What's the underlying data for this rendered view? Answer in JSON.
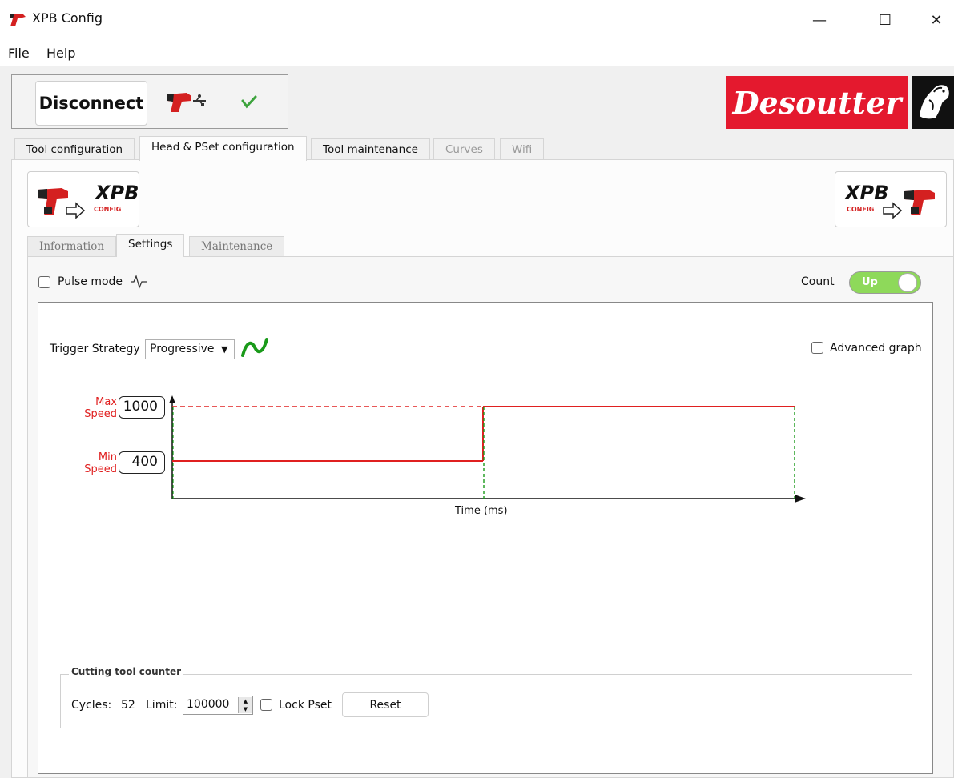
{
  "window": {
    "title": "XPB Config",
    "minimize_glyph": "—",
    "maximize_glyph": "☐",
    "close_glyph": "✕"
  },
  "menu": [
    "File",
    "Help"
  ],
  "connection": {
    "button_label": "Disconnect",
    "usb_icon": "drill-usb-icon",
    "status_icon": "check-icon",
    "status_color": "#3ca33c"
  },
  "brand": {
    "name": "Desoutter",
    "color": "#e4192e"
  },
  "main_tabs": [
    {
      "label": "Tool configuration",
      "state": "normal"
    },
    {
      "label": "Head & PSet configuration",
      "state": "active"
    },
    {
      "label": "Tool maintenance",
      "state": "normal"
    },
    {
      "label": "Curves",
      "state": "disabled"
    },
    {
      "label": "Wifi",
      "state": "disabled"
    }
  ],
  "xpb_buttons": {
    "left": {
      "title": "XPB",
      "subtitle": "CONFIG",
      "icon": "drill-to-xpb-icon"
    },
    "right": {
      "title": "XPB",
      "subtitle": "CONFIG",
      "icon": "xpb-to-drill-icon"
    }
  },
  "sub_tabs": [
    {
      "label": "Information",
      "state": "normal"
    },
    {
      "label": "Settings",
      "state": "active"
    },
    {
      "label": "Maintenance",
      "state": "normal"
    }
  ],
  "settings": {
    "pulse_mode_label": "Pulse mode",
    "pulse_mode_checked": false,
    "count_label": "Count",
    "count_toggle_label": "Up",
    "count_toggle_color": "#8ed95a",
    "trigger_strategy_label": "Trigger Strategy",
    "trigger_strategy_value": "Progressive",
    "advanced_graph_label": "Advanced graph",
    "advanced_graph_checked": false
  },
  "speed_graph": {
    "max_label_line1": "Max",
    "max_label_line2": "Speed",
    "min_label_line1": "Min",
    "min_label_line2": "Speed",
    "max_speed": "1000",
    "min_speed": "400",
    "x_axis_label": "Time (ms)",
    "line_color": "#e02020",
    "marker_color": "#1a9a1a"
  },
  "cutting_counter": {
    "title": "Cutting tool counter",
    "cycles_label": "Cycles:",
    "cycles_value": "52",
    "limit_label": "Limit:",
    "limit_value": "100000",
    "lock_label": "Lock Pset",
    "lock_checked": false,
    "reset_label": "Reset"
  }
}
